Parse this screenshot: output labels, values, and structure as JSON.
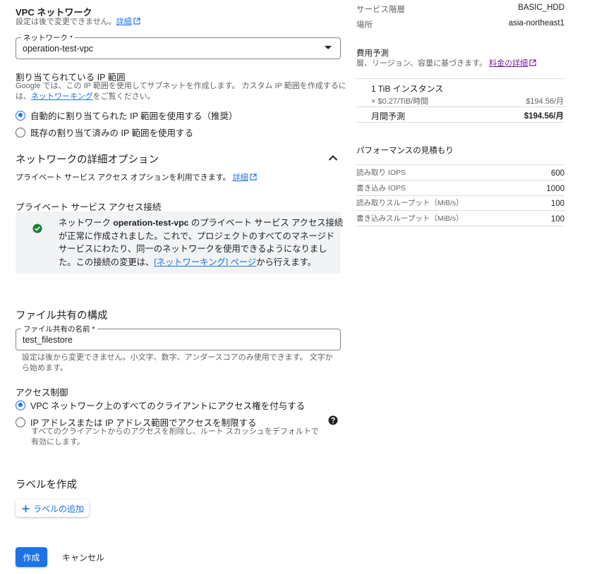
{
  "vpc": {
    "title": "VPC ネットワーク",
    "subtitle": "設定は後で変更できません。",
    "details_link": "詳細",
    "field_label": "ネットワーク *",
    "field_value": "operation-test-vpc"
  },
  "ip_range": {
    "title": "割り当てられている IP 範囲",
    "desc_line1": "Google では、この IP 範囲を使用してサブネットを作成します。 カスタム IP 範囲を作成するに",
    "desc_line2_prefix": "は、",
    "desc_link": "ネットワーキング",
    "desc_line2_suffix": "をご覧ください。",
    "options": [
      {
        "label": "自動的に割り当てられた IP 範囲を使用する（推奨）",
        "selected": true
      },
      {
        "label": "既存の割り当て済みの IP 範囲を使用する",
        "selected": false
      }
    ]
  },
  "advanced": {
    "title": "ネットワークの詳細オプション",
    "desc": "プライベート サービス アクセス オプションを利用できます。",
    "details_link": "詳細"
  },
  "psa": {
    "title": "プライベート サービス アクセス接続",
    "line1_prefix": "ネットワーク ",
    "line1_bold": "operation-test-vpc",
    "line1_suffix": " のプライベート サービス アクセス接続",
    "line2": "が正常に作成されました。これで、プロジェクトのすべてのマネージド",
    "line3": "サービスにわたり、同一のネットワークを使用できるようになりまし",
    "line4_prefix": "た。この接続の変更は、",
    "line4_link": "[ネットワーキング] ページ",
    "line4_suffix": "から行えます。",
    "status_color": "#188038"
  },
  "share": {
    "title": "ファイル共有の構成",
    "field_label": "ファイル共有の名前 *",
    "field_value": "test_filestore",
    "hint_line1": "設定は後から変更できません。小文字、数字、アンダースコアのみ使用できます。 文字か",
    "hint_line2": "ら始めます。"
  },
  "access": {
    "title": "アクセス制御",
    "options": [
      {
        "label": "VPC ネットワーク上のすべてのクライアントにアクセス権を付与する",
        "selected": true,
        "desc1": "",
        "desc2": ""
      },
      {
        "label": "IP アドレスまたは IP アドレス範囲でアクセスを制限する",
        "selected": false,
        "desc1": "すべてのクライアントからのアクセスを削除し、ルート スカッシュをデフォルトで",
        "desc2": "有効にします。"
      }
    ]
  },
  "labels": {
    "title": "ラベルを作成",
    "add_button": "ラベルの追加"
  },
  "actions": {
    "create": "作成",
    "cancel": "キャンセル"
  },
  "summary": {
    "service_tier_label": "サービス階層",
    "service_tier_value": "BASIC_HDD",
    "location_label": "場所",
    "location_value": "asia-northeast1"
  },
  "cost": {
    "title": "費用予測",
    "subtitle": "層、リージョン、容量に基づきます。",
    "pricing_link": "料金の詳細",
    "instance_label": "1 TiB インスタンス",
    "rate": "× $0.27/TiB/時間",
    "rate_value": "$194.56/月",
    "monthly_label": "月間予測",
    "monthly_value": "$194.56/月"
  },
  "performance": {
    "title": "パフォーマンスの見積もり",
    "rows": [
      {
        "label": "読み取り IOPS",
        "value": "600"
      },
      {
        "label": "書き込み IOPS",
        "value": "1000"
      },
      {
        "label": "読み取りスループット（MiB/s）",
        "value": "100"
      },
      {
        "label": "書き込みスループット（MiB/s）",
        "value": "100"
      }
    ]
  },
  "colors": {
    "accent": "#1a73e8",
    "visited_link": "#7b1fa2",
    "card_bg": "#f1f3f4"
  }
}
